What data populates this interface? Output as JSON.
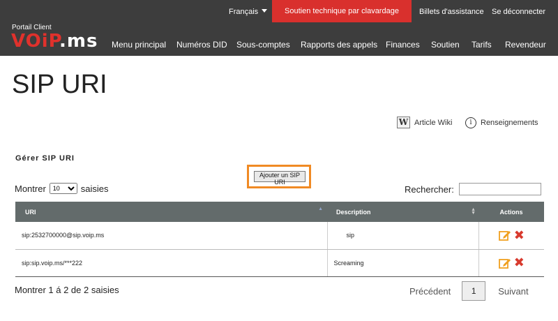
{
  "top": {
    "language": "Français",
    "support_chat": "Soutien technique par clavardage",
    "tickets": "Billets d'assistance",
    "logout": "Se déconnecter"
  },
  "brand": {
    "portal_label": "Portail Client",
    "logo_red": "VOiP",
    "logo_white": ".ms",
    "accent_color": "#d9302d"
  },
  "nav": {
    "items": [
      "Menu principal",
      "Numéros DID",
      "Sous-comptes",
      "Rapports des appels",
      "Finances",
      "Soutien",
      "Tarifs",
      "Revendeur"
    ]
  },
  "page": {
    "title": "SIP URI",
    "wiki_label": "Article Wiki",
    "info_label": "Renseignements",
    "section_title": "Gérer SIP URI",
    "add_button": "Ajouter un SIP URI"
  },
  "controls": {
    "show_prefix": "Montrer",
    "show_value": "10",
    "show_suffix": "saisies",
    "search_label": "Rechercher:",
    "search_value": ""
  },
  "table": {
    "headers": {
      "uri": "URI",
      "description": "Description",
      "actions": "Actions"
    },
    "rows": [
      {
        "uri": "sip:2532700000@sip.voip.ms",
        "description": "sip"
      },
      {
        "uri": "sip:sip.voip.ms/***222",
        "description": "Screaming"
      }
    ]
  },
  "footer": {
    "info": "Montrer 1 á 2 de 2 saisies",
    "previous": "Précédent",
    "current_page": "1",
    "next": "Suivant"
  }
}
